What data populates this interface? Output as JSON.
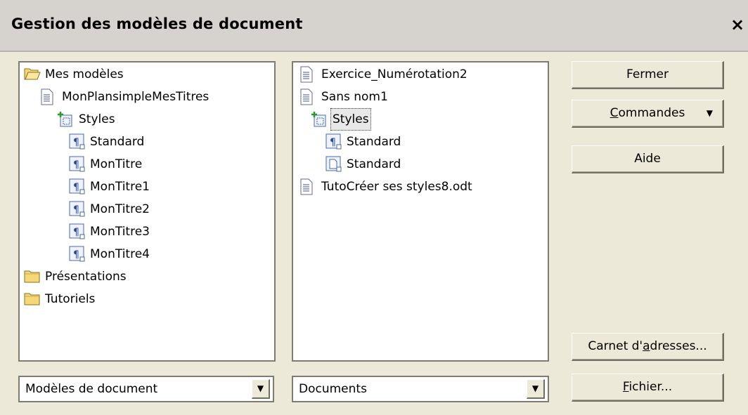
{
  "window": {
    "title": "Gestion des modèles de document",
    "close_label": "×"
  },
  "left_tree": [
    {
      "label": "Mes modèles",
      "icon": "folder-open-icon"
    },
    {
      "label": "MonPlansimpleMesTitres",
      "icon": "document-icon"
    },
    {
      "label": "Styles",
      "icon": "styles-icon"
    },
    {
      "label": "Standard",
      "icon": "paragraph-style-icon"
    },
    {
      "label": "MonTitre",
      "icon": "paragraph-style-icon"
    },
    {
      "label": "MonTitre1",
      "icon": "paragraph-style-icon"
    },
    {
      "label": "MonTitre2",
      "icon": "paragraph-style-icon"
    },
    {
      "label": "MonTitre3",
      "icon": "paragraph-style-icon"
    },
    {
      "label": "MonTitre4",
      "icon": "paragraph-style-icon"
    },
    {
      "label": "Présentations",
      "icon": "folder-icon"
    },
    {
      "label": "Tutoriels",
      "icon": "folder-icon"
    }
  ],
  "right_tree": [
    {
      "label": "Exercice_Numérotation2",
      "icon": "document-icon"
    },
    {
      "label": "Sans nom1",
      "icon": "document-icon"
    },
    {
      "label": "Styles",
      "icon": "styles-icon",
      "selected": true
    },
    {
      "label": "Standard",
      "icon": "paragraph-style-icon"
    },
    {
      "label": "Standard",
      "icon": "page-style-icon"
    },
    {
      "label": "TutoCréer ses styles8.odt",
      "icon": "document-icon"
    }
  ],
  "buttons": {
    "fermer": "Fermer",
    "commandes_u": "C",
    "commandes_rest": "ommandes",
    "aide": "Aide",
    "carnet_pre": "Carnet d'",
    "carnet_u": "a",
    "carnet_post": "dresses...",
    "fichier_u": "F",
    "fichier_rest": "ichier..."
  },
  "selects": {
    "left_value": "Modèles de document",
    "right_value": "Documents"
  }
}
